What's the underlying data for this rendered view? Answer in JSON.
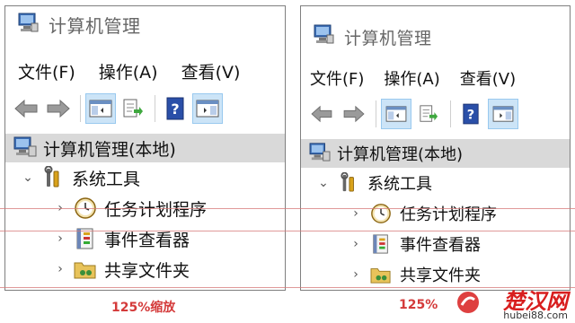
{
  "left": {
    "title": "计算机管理",
    "menu": [
      "文件(F)",
      "操作(A)",
      "查看(V)"
    ],
    "tree_root": "计算机管理(本地)",
    "tree_l1": "系统工具",
    "tree_l2": [
      "任务计划程序",
      "事件查看器",
      "共享文件夹"
    ],
    "caption": "125%缩放"
  },
  "right": {
    "title": "计算机管理",
    "menu": [
      "文件(F)",
      "操作(A)",
      "查看(V)"
    ],
    "tree_root": "计算机管理(本地)",
    "tree_l1": "系统工具",
    "tree_l2": [
      "任务计划程序",
      "事件查看器",
      "共享文件夹"
    ],
    "caption": "125%"
  },
  "watermark": {
    "brand": "楚汉网",
    "url": "hubei88.com"
  },
  "colors": {
    "accent": "#d43a3a",
    "selection": "#cce4f7",
    "root_bg": "#d9d9d9"
  },
  "icons": [
    "computer-management-icon",
    "back-arrow-icon",
    "forward-arrow-icon",
    "show-hide-tree-icon",
    "export-list-icon",
    "help-icon",
    "action-pane-icon",
    "tools-icon",
    "clock-icon",
    "event-viewer-icon",
    "shared-folder-icon"
  ]
}
